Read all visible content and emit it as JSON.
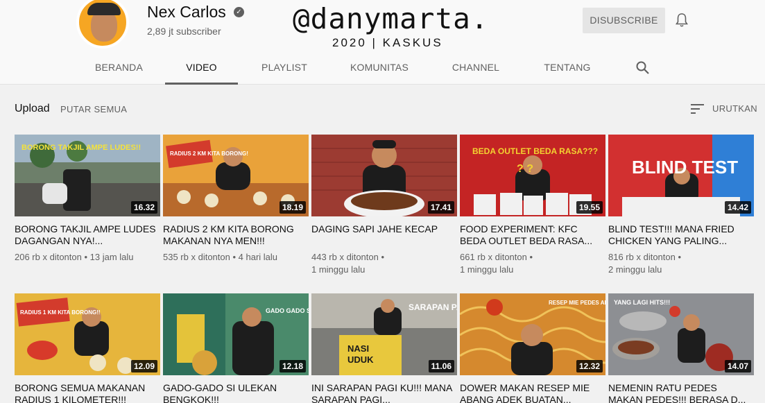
{
  "channel": {
    "name": "Nex Carlos",
    "subscribers": "2,89 jt subscriber",
    "subscribe_label": "DISUBSCRIBE"
  },
  "watermark": {
    "handle": "@danymarta.",
    "caption": "2020 | KASKUS"
  },
  "tabs": [
    {
      "label": "BERANDA"
    },
    {
      "label": "VIDEO"
    },
    {
      "label": "PLAYLIST"
    },
    {
      "label": "KOMUNITAS"
    },
    {
      "label": "CHANNEL"
    },
    {
      "label": "TENTANG"
    }
  ],
  "section": {
    "title": "Upload",
    "play_all": "PUTAR SEMUA",
    "sort_label": "URUTKAN"
  },
  "videos": [
    {
      "title": "BORONG TAKJIL AMPE LUDES DAGANGAN NYA!...",
      "views": "206 rb x ditonton",
      "age": "13 jam lalu",
      "duration": "16.32",
      "thumb_text": "BORONG TAKJIL AMPE LUDES!!",
      "thumb_color": "#6d7f6a"
    },
    {
      "title": "RADIUS 2 KM KITA BORONG MAKANAN NYA MEN!!!",
      "views": "535 rb x ditonton",
      "age": "4 hari lalu",
      "duration": "18.19",
      "thumb_text": "RADIUS 2 KM KITA BORONG!",
      "thumb_color": "#e9a23a"
    },
    {
      "title": "DAGING SAPI JAHE KECAP",
      "views": "443 rb x ditonton",
      "age": "1 minggu lalu",
      "duration": "17.41",
      "thumb_text": "",
      "thumb_color": "#9c3b32"
    },
    {
      "title": "FOOD EXPERIMENT: KFC BEDA OUTLET BEDA RASA...",
      "views": "661 rb x ditonton",
      "age": "1 minggu lalu",
      "duration": "19.55",
      "thumb_text": "BEDA OUTLET BEDA RASA???",
      "thumb_color": "#c42424"
    },
    {
      "title": "BLIND TEST!!! MANA FRIED CHICKEN YANG PALING...",
      "views": "816 rb x ditonton",
      "age": "2 minggu lalu",
      "duration": "14.42",
      "thumb_text": "BLIND TEST",
      "thumb_color": "#d23030"
    },
    {
      "title": "BORONG SEMUA MAKANAN RADIUS 1 KILOMETER!!!",
      "views": "",
      "age": "",
      "duration": "12.09",
      "thumb_text": "RADIUS 1 KM KITA BORONG!!",
      "thumb_color": "#e6b53c"
    },
    {
      "title": "GADO-GADO SI ULEKAN BENGKOK!!!",
      "views": "",
      "age": "",
      "duration": "12.18",
      "thumb_text": "GADO GADO SI ULEKAN BENGKOK",
      "thumb_color": "#4a8a6b"
    },
    {
      "title": "INI SARAPAN PAGI KU!!! MANA SARAPAN PAGI...",
      "views": "",
      "age": "",
      "duration": "11.06",
      "thumb_text": "SARAPAN PAGI",
      "thumb_color": "#7c7c78"
    },
    {
      "title": "DOWER MAKAN RESEP MIE ABANG ADEK BUATAN...",
      "views": "",
      "age": "",
      "duration": "12.32",
      "thumb_text": "RESEP MIE PEDES ABANG ADEK!!!",
      "thumb_color": "#d5892e"
    },
    {
      "title": "NEMENIN RATU PEDES MAKAN PEDES!!! BERASA D...",
      "views": "",
      "age": "",
      "duration": "14.07",
      "thumb_text": "YANG LAGI HITS!!!",
      "thumb_color": "#8d8f93"
    }
  ]
}
